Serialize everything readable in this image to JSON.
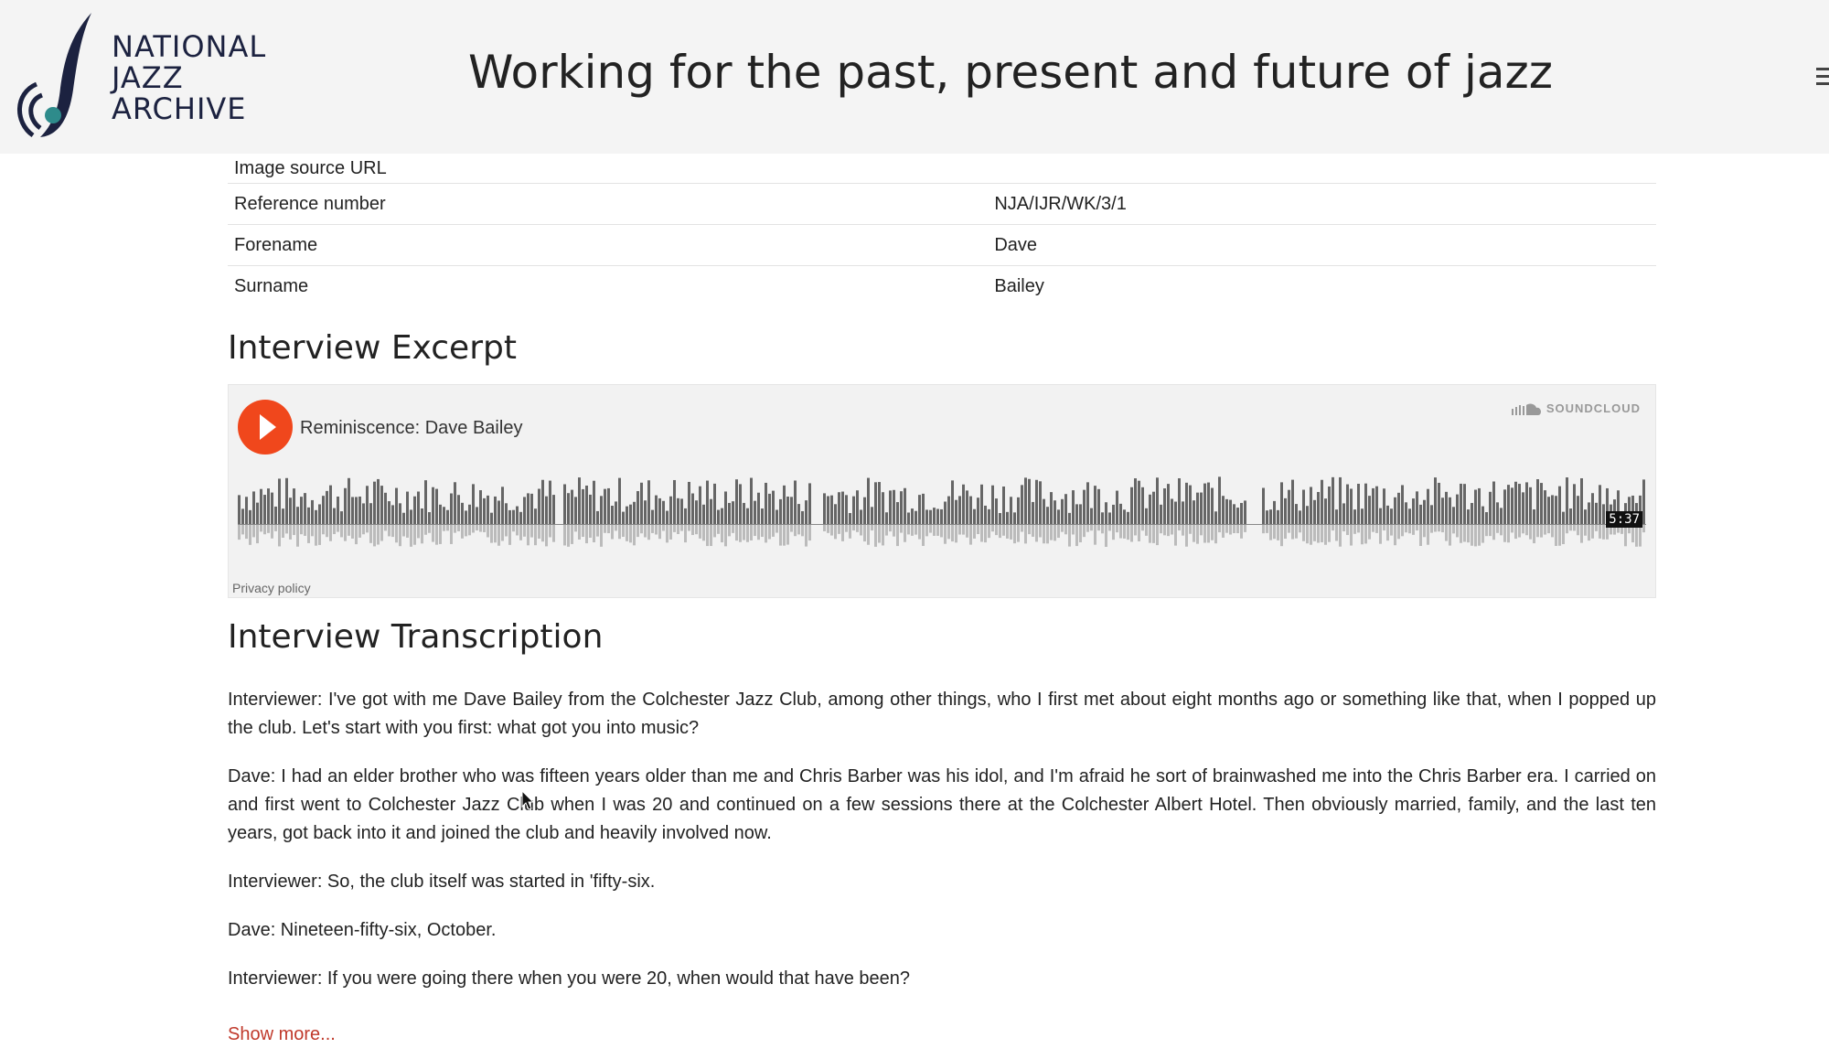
{
  "header": {
    "logo_lines": [
      "NATIONAL",
      "JAZZ",
      "ARCHIVE"
    ],
    "tagline": "Working for the past, present and future of jazz"
  },
  "info_table": [
    {
      "label": "Image source URL",
      "value": ""
    },
    {
      "label": "Reference number",
      "value": "NJA/IJR/WK/3/1"
    },
    {
      "label": "Forename",
      "value": "Dave"
    },
    {
      "label": "Surname",
      "value": "Bailey"
    }
  ],
  "excerpt": {
    "heading": "Interview Excerpt",
    "track_title": "Reminiscence: Dave Bailey",
    "brand": "SOUNDCLOUD",
    "duration": "5:37",
    "privacy": "Privacy policy"
  },
  "transcription": {
    "heading": "Interview Transcription",
    "paragraphs": [
      "Interviewer: I've got with me Dave Bailey from the Colchester Jazz Club, among other things, who I first met about eight months ago or something like that, when I popped up the club. Let's start with you first: what got you into music?",
      "Dave: I had an elder brother who was fifteen years older than me and Chris Barber was his idol, and I'm afraid he sort of brainwashed me into the Chris Barber era. I carried on and first went to Colchester Jazz Club when I was 20 and continued on a few sessions there at the Colchester Albert Hotel. Then obviously married, family, and the last ten years, got back into it and joined the club and heavily involved now.",
      "Interviewer: So, the club itself was started in 'fifty-six.",
      "Dave: Nineteen-fifty-six, October.",
      "Interviewer: If you were going there when you were 20, when would that have been?"
    ],
    "show_more": "Show more..."
  },
  "colors": {
    "play_button": "#f0471c",
    "link": "#c0392b",
    "header_bg": "#f4f4f4",
    "logo_navy": "#1c2240",
    "logo_teal": "#2e8b8b"
  }
}
